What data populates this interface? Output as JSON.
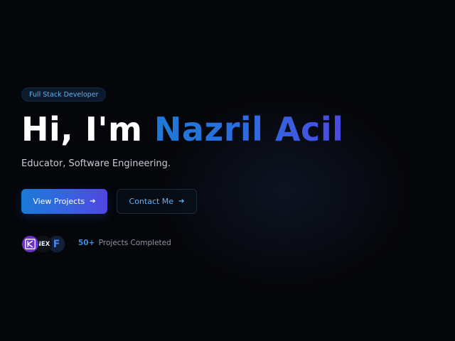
{
  "hero": {
    "badge": "Full Stack Developer",
    "greeting": "Hi, I'm",
    "name": "Nazril Acil",
    "subtitle": "Educator, Software Engineering."
  },
  "actions": {
    "primary_label": "View Projects",
    "primary_icon": "arrow-right-icon",
    "secondary_label": "Contact Me",
    "secondary_icon": "arrow-right-icon"
  },
  "stats": {
    "avatars": [
      {
        "icon": "kotlin-logo-icon",
        "color": "#6b34c8"
      },
      {
        "text": "NEX",
        "icon": "nextjs-logo-icon",
        "color": "#0e1118"
      },
      {
        "text": "F",
        "icon": "f-logo-icon",
        "color": "#13203a"
      }
    ],
    "count": "50+",
    "label": "Projects Completed"
  },
  "colors": {
    "background": "#05060a",
    "accent_blue": "#1e7ad6",
    "accent_purple": "#4b4ae0",
    "link": "#63b4f2"
  }
}
